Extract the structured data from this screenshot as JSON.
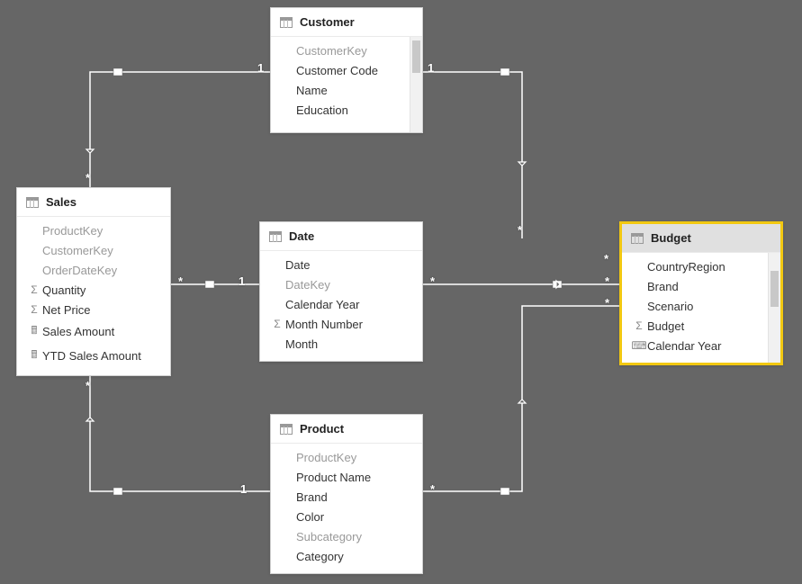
{
  "tables": {
    "sales": {
      "title": "Sales",
      "fields": [
        {
          "label": "ProductKey",
          "dimmed": true,
          "icon": ""
        },
        {
          "label": "CustomerKey",
          "dimmed": true,
          "icon": ""
        },
        {
          "label": "OrderDateKey",
          "dimmed": true,
          "icon": ""
        },
        {
          "label": "Quantity",
          "dimmed": false,
          "icon": "sigma"
        },
        {
          "label": "Net Price",
          "dimmed": false,
          "icon": "sigma"
        },
        {
          "label": "Sales Amount",
          "dimmed": false,
          "icon": "calc"
        },
        {
          "label": "YTD Sales Amount",
          "dimmed": false,
          "icon": "calc"
        }
      ]
    },
    "customer": {
      "title": "Customer",
      "fields": [
        {
          "label": "CustomerKey",
          "dimmed": true,
          "icon": ""
        },
        {
          "label": "Customer Code",
          "dimmed": false,
          "icon": ""
        },
        {
          "label": "Name",
          "dimmed": false,
          "icon": ""
        },
        {
          "label": "Education",
          "dimmed": false,
          "icon": ""
        }
      ],
      "has_scroll": true
    },
    "date": {
      "title": "Date",
      "fields": [
        {
          "label": "Date",
          "dimmed": false,
          "icon": ""
        },
        {
          "label": "DateKey",
          "dimmed": true,
          "icon": ""
        },
        {
          "label": "Calendar Year",
          "dimmed": false,
          "icon": ""
        },
        {
          "label": "Month Number",
          "dimmed": false,
          "icon": "sigma"
        },
        {
          "label": "Month",
          "dimmed": false,
          "icon": ""
        }
      ]
    },
    "product": {
      "title": "Product",
      "fields": [
        {
          "label": "ProductKey",
          "dimmed": true,
          "icon": ""
        },
        {
          "label": "Product Name",
          "dimmed": false,
          "icon": ""
        },
        {
          "label": "Brand",
          "dimmed": false,
          "icon": ""
        },
        {
          "label": "Color",
          "dimmed": false,
          "icon": ""
        },
        {
          "label": "Subcategory",
          "dimmed": true,
          "icon": ""
        },
        {
          "label": "Category",
          "dimmed": false,
          "icon": ""
        }
      ]
    },
    "budget": {
      "title": "Budget",
      "selected": true,
      "fields": [
        {
          "label": "CountryRegion",
          "dimmed": false,
          "icon": ""
        },
        {
          "label": "Brand",
          "dimmed": false,
          "icon": ""
        },
        {
          "label": "Scenario",
          "dimmed": false,
          "icon": ""
        },
        {
          "label": "Budget",
          "dimmed": false,
          "icon": "sigma"
        },
        {
          "label": "Calendar Year",
          "dimmed": false,
          "icon": "datecol"
        }
      ],
      "has_scroll": true
    }
  },
  "cardinality": {
    "one": "1",
    "many": "*"
  },
  "icons": {
    "sigma": "Σ",
    "calc": "🖩",
    "datecol": "⌨"
  },
  "relationships": [
    {
      "from": "Customer",
      "to": "Sales",
      "type": "1:*"
    },
    {
      "from": "Customer",
      "to": "Budget",
      "type": "1:*"
    },
    {
      "from": "Date",
      "to": "Sales",
      "type": "1:*"
    },
    {
      "from": "Date",
      "to": "Budget",
      "type": "1:*"
    },
    {
      "from": "Product",
      "to": "Sales",
      "type": "1:*"
    },
    {
      "from": "Product",
      "to": "Budget",
      "type": "1:*"
    }
  ]
}
